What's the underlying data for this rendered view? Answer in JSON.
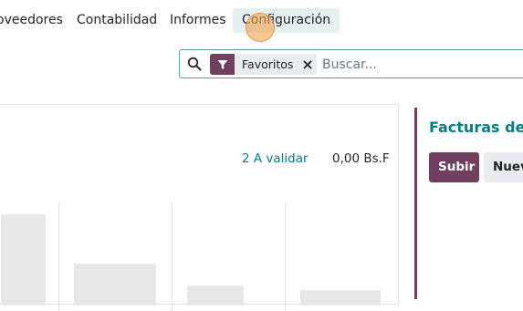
{
  "nav": {
    "items": [
      {
        "label": "oveedores"
      },
      {
        "label": "Contabilidad"
      },
      {
        "label": "Informes"
      },
      {
        "label": "Configuración"
      }
    ]
  },
  "search": {
    "facet_label": "Favoritos",
    "placeholder": "Buscar...",
    "value": ""
  },
  "dashboard": {
    "to_validate": "2 A validar",
    "amount": "0,00 Bs.F"
  },
  "side_card": {
    "title": "Facturas de p",
    "upload_label": "Subir",
    "new_label": "Nuev"
  },
  "colors": {
    "brand": "#71405e",
    "link": "#017e84",
    "active_menu_bg": "#e6f0f1"
  },
  "icons": {
    "search": "search-icon",
    "facet": "filter-icon",
    "remove": "close-icon"
  }
}
